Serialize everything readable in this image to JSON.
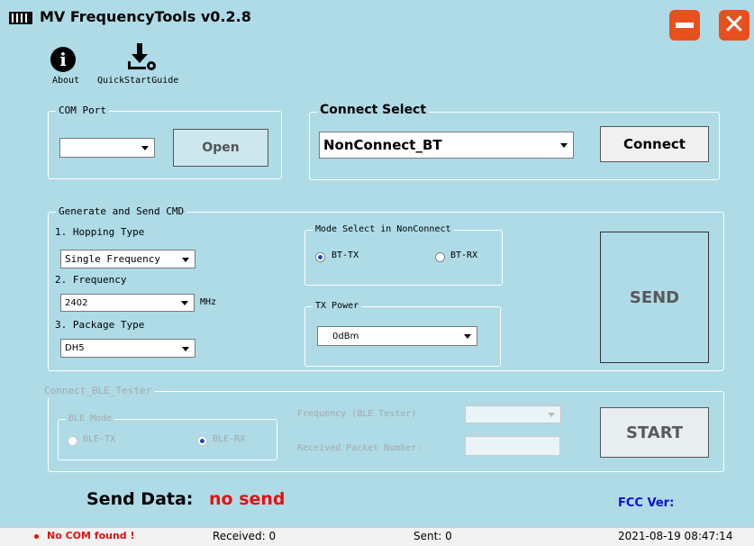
{
  "window": {
    "title": "MV FrequencyTools v0.2.8"
  },
  "toolbar": {
    "about_label": "About",
    "guide_label": "QuickStartGuide"
  },
  "com_port": {
    "legend": "COM Port",
    "selected": "",
    "open_label": "Open"
  },
  "connect_select": {
    "legend": "Connect Select",
    "selected": "NonConnect_BT",
    "connect_label": "Connect"
  },
  "generate": {
    "legend": "Generate and Send CMD",
    "hopping_label": "1. Hopping Type",
    "hopping_value": "Single Frequency",
    "frequency_label": "2. Frequency",
    "frequency_value": "2402",
    "frequency_unit": "MHz",
    "package_label": "3. Package Type",
    "package_value": "DH5",
    "mode_legend": "Mode Select in NonConnect",
    "mode_tx": "BT-TX",
    "mode_rx": "BT-RX",
    "mode_selected": "BT-TX",
    "tx_power_legend": "TX Power",
    "tx_power_value": "0dBm",
    "send_label": "SEND"
  },
  "ble": {
    "legend": "Connect_BLE_Tester",
    "mode_legend": "BLE Mode",
    "mode_tx": "BLE-TX",
    "mode_rx": "BLE-RX",
    "mode_selected": "BLE-RX",
    "frequency_label": "Frequency (BLE Tester)",
    "frequency_value": "",
    "received_label": "Received Packet Number:",
    "received_value": "",
    "start_label": "START"
  },
  "send_data": {
    "label": "Send Data:",
    "value": "no send",
    "fcc_label": "FCC Ver:"
  },
  "status": {
    "com_status": "No COM found !",
    "received": "Received: 0",
    "sent": "Sent: 0",
    "datetime": "2021-08-19 08:47:14"
  },
  "colors": {
    "background": "#aedbe6",
    "accent_orange": "#e8501e",
    "send_red": "#e81010",
    "fcc_blue": "#1010d0"
  }
}
